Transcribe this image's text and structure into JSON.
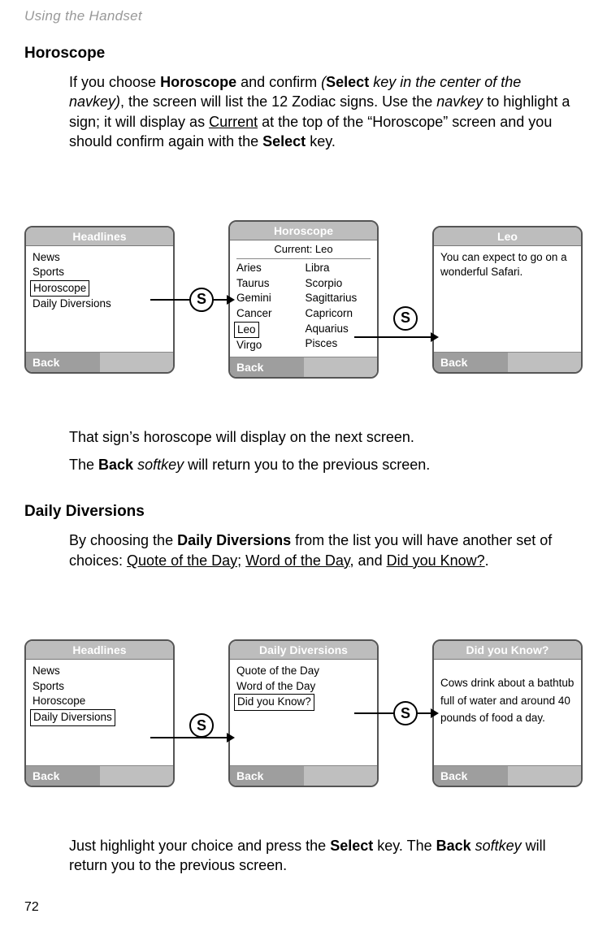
{
  "running_head": "Using the Handset",
  "horoscope": {
    "title": "Horoscope",
    "para1_pre": "If you choose ",
    "para1_b1": "Horoscope",
    "para1_mid1": " and confirm ",
    "para1_i_open": "(",
    "para1_b2": "Select",
    "para1_i_mid": " key in the center of the navkey)",
    "para1_mid2": ", the screen will list the 12 Zodiac signs. Use the ",
    "para1_i2": "navkey",
    "para1_mid3": " to highlight a sign; it will display as ",
    "para1_u1": "Current",
    "para1_mid4": " at the top of the “Horoscope” screen and you should confirm again with the ",
    "para1_b3": "Select",
    "para1_end": " key.",
    "para2": "That sign’s horoscope will display on the next screen.",
    "para3_pre": "The ",
    "para3_b": "Back",
    "para3_i": " softkey",
    "para3_end": " will return you to the previous screen."
  },
  "dd": {
    "title": "Daily Diversions",
    "para1_pre": "By choosing the ",
    "para1_b": "Daily Diversions",
    "para1_mid": " from the list you will have another set of choices: ",
    "para1_u1": "Quote of the Day;",
    "para1_sp": " ",
    "para1_u2": "Word of the Day",
    "para1_mid2": ", and ",
    "para1_u3": "Did you Know?",
    "para1_end": ".",
    "para2_pre": "Just highlight your choice and press the ",
    "para2_b1": "Select",
    "para2_mid": " key. The ",
    "para2_b2": "Back",
    "para2_i": " softkey",
    "para2_end": " will return you to the previous screen."
  },
  "screens": {
    "headlines": {
      "title": "Headlines",
      "items": [
        "News",
        "Sports",
        "Horoscope",
        "Daily Diversions"
      ],
      "back": "Back"
    },
    "horoscope": {
      "title": "Horoscope",
      "current": "Current: Leo",
      "left": [
        "Aries",
        "Taurus",
        "Gemini",
        "Cancer",
        "Leo",
        "Virgo"
      ],
      "right": [
        "Libra",
        "Scorpio",
        "Sagittarius",
        "Capricorn",
        "Aquarius",
        "Pisces"
      ],
      "back": "Back"
    },
    "leo": {
      "title": "Leo",
      "text": "You can expect to go on a wonderful Safari.",
      "back": "Back"
    },
    "diversions": {
      "title": "Daily Diversions",
      "items": [
        "Quote of the Day",
        "Word of the Day",
        "Did you Know?"
      ],
      "back": "Back"
    },
    "dyk": {
      "title": "Did you Know?",
      "text": "Cows drink about a bathtub full of water and around 40 pounds of food a day.",
      "back": "Back"
    }
  },
  "select_glyph": "S",
  "page_number": "72"
}
